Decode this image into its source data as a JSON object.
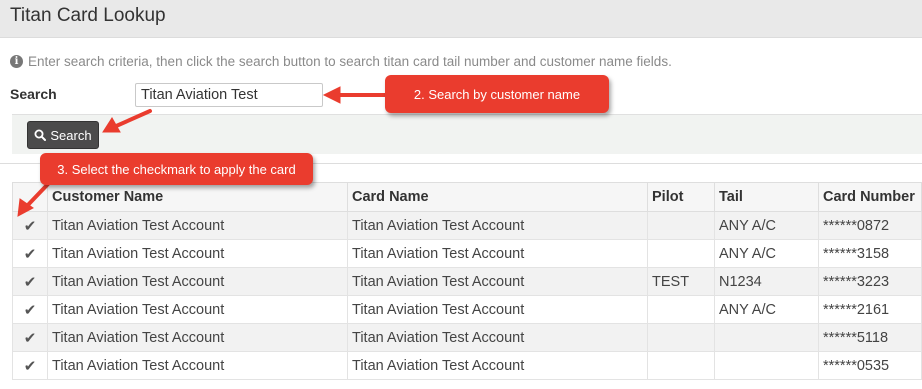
{
  "header": {
    "title": "Titan Card Lookup"
  },
  "info": {
    "icon": "info-circle-icon",
    "text": "Enter search criteria, then click the search button to search titan card tail number and customer name fields."
  },
  "search": {
    "label": "Search",
    "value": "Titan Aviation Test",
    "button_label": "Search"
  },
  "callouts": {
    "step2": "2. Search by customer name",
    "step3": "3. Select the checkmark to apply the card",
    "color": "#ea3c2e"
  },
  "table": {
    "columns": [
      "",
      "Customer Name",
      "Card Name",
      "Pilot",
      "Tail",
      "Card Number"
    ],
    "rows": [
      {
        "check": "✔",
        "customer": "Titan Aviation Test Account",
        "card": "Titan Aviation Test Account",
        "pilot": "",
        "tail": "ANY A/C",
        "number": "******0872"
      },
      {
        "check": "✔",
        "customer": "Titan Aviation Test Account",
        "card": "Titan Aviation Test Account",
        "pilot": "",
        "tail": "ANY A/C",
        "number": "******3158"
      },
      {
        "check": "✔",
        "customer": "Titan Aviation Test Account",
        "card": "Titan Aviation Test Account",
        "pilot": "TEST",
        "tail": "N1234",
        "number": "******3223"
      },
      {
        "check": "✔",
        "customer": "Titan Aviation Test Account",
        "card": "Titan Aviation Test Account",
        "pilot": "",
        "tail": "ANY A/C",
        "number": "******2161"
      },
      {
        "check": "✔",
        "customer": "Titan Aviation Test Account",
        "card": "Titan Aviation Test Account",
        "pilot": "",
        "tail": "",
        "number": "******5118"
      },
      {
        "check": "✔",
        "customer": "Titan Aviation Test Account",
        "card": "Titan Aviation Test Account",
        "pilot": "",
        "tail": "",
        "number": "******0535"
      }
    ]
  }
}
